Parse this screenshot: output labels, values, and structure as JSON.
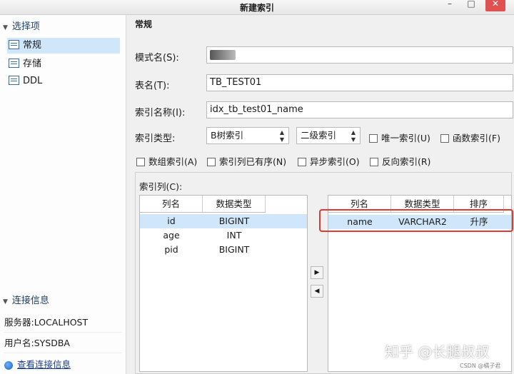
{
  "window": {
    "title": "新建索引",
    "minimize_glyph": "–",
    "maximize_glyph": "□",
    "close_glyph": "✕"
  },
  "left": {
    "options_header": "选择项",
    "nav_items": [
      "常规",
      "存储",
      "DDL"
    ],
    "connection_header": "连接信息",
    "server_label": "服务器:",
    "server_value": "LOCALHOST",
    "user_label": "用户名:",
    "user_value": "SYSDBA",
    "view_conn_link": "查看连接信息"
  },
  "main": {
    "tab_title": "常规",
    "schema_label": "模式名(S):",
    "table_label": "表名(T):",
    "table_value": "TB_TEST01",
    "index_name_label": "索引名称(I):",
    "index_name_value": "idx_tb_test01_name",
    "index_type_label": "索引类型:",
    "index_type_value": "B树索引",
    "index_level_value": "二级索引",
    "unique_label": "唯一索引(U)",
    "function_label": "函数索引(F)",
    "array_label": "数组索引(A)",
    "sorted_label": "索引列已有序(N)",
    "async_label": "异步索引(O)",
    "reverse_label": "反向索引(R)",
    "columns_group_label": "索引列(C):",
    "source_headers": [
      "列名",
      "数据类型"
    ],
    "source_rows": [
      {
        "name": "id",
        "type": "BIGINT"
      },
      {
        "name": "age",
        "type": "INT"
      },
      {
        "name": "pid",
        "type": "BIGINT"
      }
    ],
    "target_headers": [
      "列名",
      "数据类型",
      "排序"
    ],
    "target_rows": [
      {
        "name": "name",
        "type": "VARCHAR2",
        "order": "升序"
      }
    ],
    "add_arrow": "▶",
    "remove_arrow": "◀"
  },
  "watermark": {
    "main": "知乎 @长腿叔叔",
    "small": "CSDN @橘子君"
  }
}
